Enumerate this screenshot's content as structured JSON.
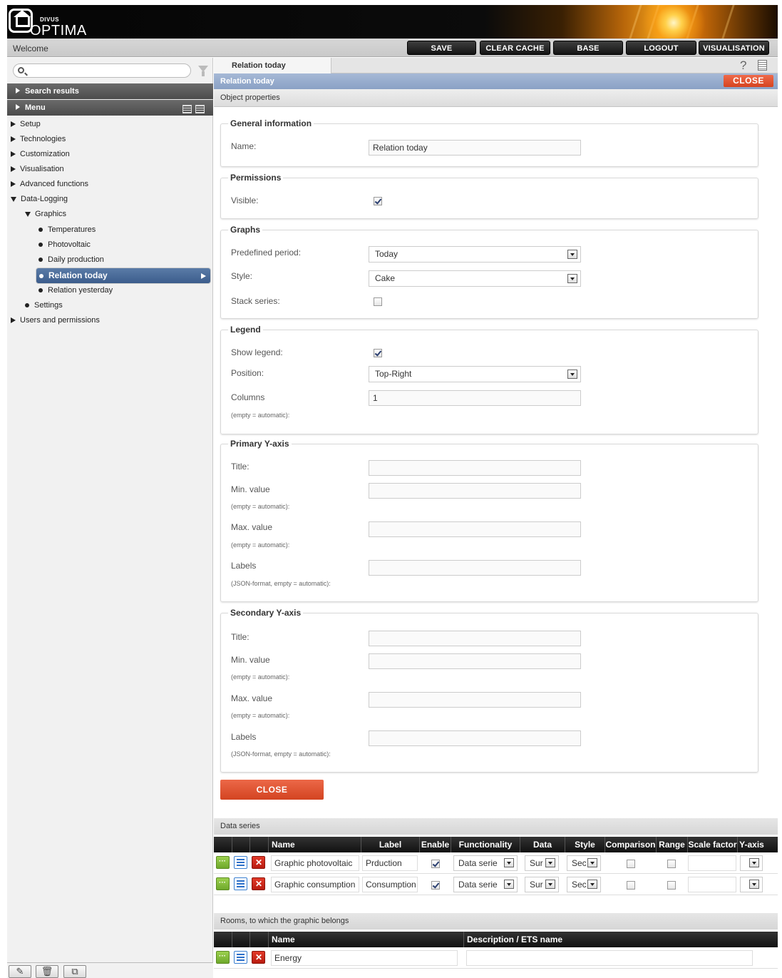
{
  "header": {
    "brand_small": "DIVUS",
    "brand": "OPTIMA"
  },
  "topbar": {
    "welcome": "Welcome",
    "buttons": {
      "save": "SAVE",
      "clear_cache": "CLEAR CACHE",
      "base": "BASE",
      "logout": "LOGOUT",
      "visualisation": "VISUALISATION"
    }
  },
  "sidebar": {
    "search": {
      "placeholder": ""
    },
    "search_results": "Search results",
    "menu": "Menu",
    "tree": {
      "setup": "Setup",
      "technologies": "Technologies",
      "customization": "Customization",
      "visualisation": "Visualisation",
      "advanced_functions": "Advanced functions",
      "data_logging": "Data-Logging",
      "graphics": "Graphics",
      "temperatures": "Temperatures",
      "photovoltaic": "Photovoltaic",
      "daily_production": "Daily production",
      "relation_today": "Relation today",
      "relation_yesterday": "Relation yesterday",
      "settings": "Settings",
      "users_permissions": "Users and permissions"
    }
  },
  "main": {
    "tab": "Relation today",
    "title": "Relation today",
    "close_top": "CLOSE",
    "object_properties": "Object properties",
    "general": {
      "legend": "General information",
      "name_label": "Name:",
      "name_value": "Relation today"
    },
    "permissions": {
      "legend": "Permissions",
      "visible_label": "Visible:",
      "visible": true
    },
    "graphs": {
      "legend": "Graphs",
      "period_label": "Predefined period:",
      "period_value": "Today",
      "style_label": "Style:",
      "style_value": "Cake",
      "stack_label": "Stack series:",
      "stack": false
    },
    "legend_section": {
      "legend": "Legend",
      "show_label": "Show legend:",
      "show": true,
      "position_label": "Position:",
      "position_value": "Top-Right",
      "columns_label": "Columns",
      "columns_value": "1",
      "columns_hint": "(empty = automatic):"
    },
    "primary_y": {
      "legend": "Primary Y-axis",
      "title_label": "Title:",
      "min_label": "Min. value",
      "min_hint": "(empty = automatic):",
      "max_label": "Max. value",
      "max_hint": "(empty = automatic):",
      "labels_label": "Labels",
      "labels_hint": "(JSON-format, empty = automatic):"
    },
    "secondary_y": {
      "legend": "Secondary Y-axis",
      "title_label": "Title:",
      "min_label": "Min. value",
      "min_hint": "(empty = automatic):",
      "max_label": "Max. value",
      "max_hint": "(empty = automatic):",
      "labels_label": "Labels",
      "labels_hint": "(JSON-format, empty = automatic):"
    },
    "close_button": "CLOSE",
    "data_series": {
      "title": "Data series",
      "columns": [
        "Name",
        "Label",
        "Enable",
        "Functionality",
        "Data",
        "Style",
        "Comparison",
        "Range",
        "Scale factor",
        "Y-axis"
      ],
      "rows": [
        {
          "name": "Graphic photovoltaic",
          "label": "Prduction",
          "enable": true,
          "functionality": "Data serie",
          "data": "Sur",
          "style": "Sec",
          "comparison": false,
          "range": false,
          "scale": "",
          "yaxis": ""
        },
        {
          "name": "Graphic consumption",
          "label": "Consumption",
          "enable": true,
          "functionality": "Data serie",
          "data": "Sur",
          "style": "Sec",
          "comparison": false,
          "range": false,
          "scale": "",
          "yaxis": ""
        }
      ]
    },
    "rooms": {
      "title": "Rooms, to which the graphic belongs",
      "columns": [
        "Name",
        "Description / ETS name"
      ],
      "rows": [
        {
          "name": "Energy",
          "description": ""
        }
      ]
    }
  },
  "footer_icons": [
    "edit-icon",
    "trash-icon",
    "copy-icon"
  ]
}
